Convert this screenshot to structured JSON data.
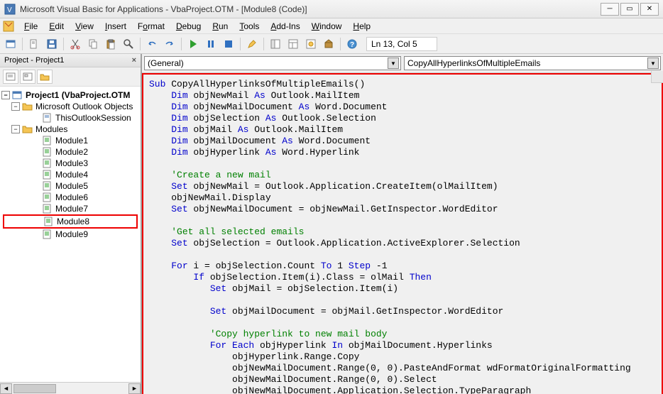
{
  "titlebar": {
    "title": "Microsoft Visual Basic for Applications - VbaProject.OTM - [Module8 (Code)]"
  },
  "menubar": {
    "items": [
      {
        "label": "File",
        "u": "F"
      },
      {
        "label": "Edit",
        "u": "E"
      },
      {
        "label": "View",
        "u": "V"
      },
      {
        "label": "Insert",
        "u": "I"
      },
      {
        "label": "Format",
        "u": "o"
      },
      {
        "label": "Debug",
        "u": "D"
      },
      {
        "label": "Run",
        "u": "R"
      },
      {
        "label": "Tools",
        "u": "T"
      },
      {
        "label": "Add-Ins",
        "u": "A"
      },
      {
        "label": "Window",
        "u": "W"
      },
      {
        "label": "Help",
        "u": "H"
      }
    ]
  },
  "toolbar": {
    "status": "Ln 13, Col 5"
  },
  "project_panel": {
    "title": "Project - Project1",
    "root": "Project1 (VbaProject.OTM",
    "folder1": "Microsoft Outlook Objects",
    "f1_item": "ThisOutlookSession",
    "folder2": "Modules",
    "modules": [
      "Module1",
      "Module2",
      "Module3",
      "Module4",
      "Module5",
      "Module6",
      "Module7",
      "Module8",
      "Module9"
    ],
    "highlighted": "Module8"
  },
  "dropdowns": {
    "left": "(General)",
    "right": "CopyAllHyperlinksOfMultipleEmails"
  },
  "code": {
    "lines": [
      {
        "t": "plain",
        "parts": [
          {
            "c": "kw",
            "s": "Sub"
          },
          {
            "c": "",
            "s": " CopyAllHyperlinksOfMultipleEmails()"
          }
        ]
      },
      {
        "t": "plain",
        "parts": [
          {
            "c": "",
            "s": "    "
          },
          {
            "c": "kw",
            "s": "Dim"
          },
          {
            "c": "",
            "s": " objNewMail "
          },
          {
            "c": "kw",
            "s": "As"
          },
          {
            "c": "",
            "s": " Outlook.MailItem"
          }
        ]
      },
      {
        "t": "plain",
        "parts": [
          {
            "c": "",
            "s": "    "
          },
          {
            "c": "kw",
            "s": "Dim"
          },
          {
            "c": "",
            "s": " objNewMailDocument "
          },
          {
            "c": "kw",
            "s": "As"
          },
          {
            "c": "",
            "s": " Word.Document"
          }
        ]
      },
      {
        "t": "plain",
        "parts": [
          {
            "c": "",
            "s": "    "
          },
          {
            "c": "kw",
            "s": "Dim"
          },
          {
            "c": "",
            "s": " objSelection "
          },
          {
            "c": "kw",
            "s": "As"
          },
          {
            "c": "",
            "s": " Outlook.Selection"
          }
        ]
      },
      {
        "t": "plain",
        "parts": [
          {
            "c": "",
            "s": "    "
          },
          {
            "c": "kw",
            "s": "Dim"
          },
          {
            "c": "",
            "s": " objMail "
          },
          {
            "c": "kw",
            "s": "As"
          },
          {
            "c": "",
            "s": " Outlook.MailItem"
          }
        ]
      },
      {
        "t": "plain",
        "parts": [
          {
            "c": "",
            "s": "    "
          },
          {
            "c": "kw",
            "s": "Dim"
          },
          {
            "c": "",
            "s": " objMailDocument "
          },
          {
            "c": "kw",
            "s": "As"
          },
          {
            "c": "",
            "s": " Word.Document"
          }
        ]
      },
      {
        "t": "plain",
        "parts": [
          {
            "c": "",
            "s": "    "
          },
          {
            "c": "kw",
            "s": "Dim"
          },
          {
            "c": "",
            "s": " objHyperlink "
          },
          {
            "c": "kw",
            "s": "As"
          },
          {
            "c": "",
            "s": " Word.Hyperlink"
          }
        ]
      },
      {
        "t": "plain",
        "parts": [
          {
            "c": "",
            "s": ""
          }
        ]
      },
      {
        "t": "plain",
        "parts": [
          {
            "c": "",
            "s": "    "
          },
          {
            "c": "cm",
            "s": "'Create a new mail"
          }
        ]
      },
      {
        "t": "plain",
        "parts": [
          {
            "c": "",
            "s": "    "
          },
          {
            "c": "kw",
            "s": "Set"
          },
          {
            "c": "",
            "s": " objNewMail = Outlook.Application.CreateItem(olMailItem)"
          }
        ]
      },
      {
        "t": "plain",
        "parts": [
          {
            "c": "",
            "s": "    objNewMail.Display"
          }
        ]
      },
      {
        "t": "plain",
        "parts": [
          {
            "c": "",
            "s": "    "
          },
          {
            "c": "kw",
            "s": "Set"
          },
          {
            "c": "",
            "s": " objNewMailDocument = objNewMail.GetInspector.WordEditor"
          }
        ]
      },
      {
        "t": "plain",
        "parts": [
          {
            "c": "",
            "s": "    "
          }
        ]
      },
      {
        "t": "plain",
        "parts": [
          {
            "c": "",
            "s": "    "
          },
          {
            "c": "cm",
            "s": "'Get all selected emails"
          }
        ]
      },
      {
        "t": "plain",
        "parts": [
          {
            "c": "",
            "s": "    "
          },
          {
            "c": "kw",
            "s": "Set"
          },
          {
            "c": "",
            "s": " objSelection = Outlook.Application.ActiveExplorer.Selection"
          }
        ]
      },
      {
        "t": "plain",
        "parts": [
          {
            "c": "",
            "s": ""
          }
        ]
      },
      {
        "t": "plain",
        "parts": [
          {
            "c": "",
            "s": "    "
          },
          {
            "c": "kw",
            "s": "For"
          },
          {
            "c": "",
            "s": " i = objSelection.Count "
          },
          {
            "c": "kw",
            "s": "To"
          },
          {
            "c": "",
            "s": " 1 "
          },
          {
            "c": "kw",
            "s": "Step"
          },
          {
            "c": "",
            "s": " -1"
          }
        ]
      },
      {
        "t": "plain",
        "parts": [
          {
            "c": "",
            "s": "        "
          },
          {
            "c": "kw",
            "s": "If"
          },
          {
            "c": "",
            "s": " objSelection.Item(i).Class = olMail "
          },
          {
            "c": "kw",
            "s": "Then"
          }
        ]
      },
      {
        "t": "plain",
        "parts": [
          {
            "c": "",
            "s": "           "
          },
          {
            "c": "kw",
            "s": "Set"
          },
          {
            "c": "",
            "s": " objMail = objSelection.Item(i)"
          }
        ]
      },
      {
        "t": "plain",
        "parts": [
          {
            "c": "",
            "s": ""
          }
        ]
      },
      {
        "t": "plain",
        "parts": [
          {
            "c": "",
            "s": "           "
          },
          {
            "c": "kw",
            "s": "Set"
          },
          {
            "c": "",
            "s": " objMailDocument = objMail.GetInspector.WordEditor"
          }
        ]
      },
      {
        "t": "plain",
        "parts": [
          {
            "c": "",
            "s": ""
          }
        ]
      },
      {
        "t": "plain",
        "parts": [
          {
            "c": "",
            "s": "           "
          },
          {
            "c": "cm",
            "s": "'Copy hyperlink to new mail body"
          }
        ]
      },
      {
        "t": "plain",
        "parts": [
          {
            "c": "",
            "s": "           "
          },
          {
            "c": "kw",
            "s": "For Each"
          },
          {
            "c": "",
            "s": " objHyperlink "
          },
          {
            "c": "kw",
            "s": "In"
          },
          {
            "c": "",
            "s": " objMailDocument.Hyperlinks"
          }
        ]
      },
      {
        "t": "plain",
        "parts": [
          {
            "c": "",
            "s": "               objHyperlink.Range.Copy"
          }
        ]
      },
      {
        "t": "plain",
        "parts": [
          {
            "c": "",
            "s": "               objNewMailDocument.Range(0, 0).PasteAndFormat wdFormatOriginalFormatting"
          }
        ]
      },
      {
        "t": "plain",
        "parts": [
          {
            "c": "",
            "s": "               objNewMailDocument.Range(0, 0).Select"
          }
        ]
      },
      {
        "t": "plain",
        "parts": [
          {
            "c": "",
            "s": "               objNewMailDocument.Application.Selection.TypeParagraph"
          }
        ]
      }
    ]
  }
}
